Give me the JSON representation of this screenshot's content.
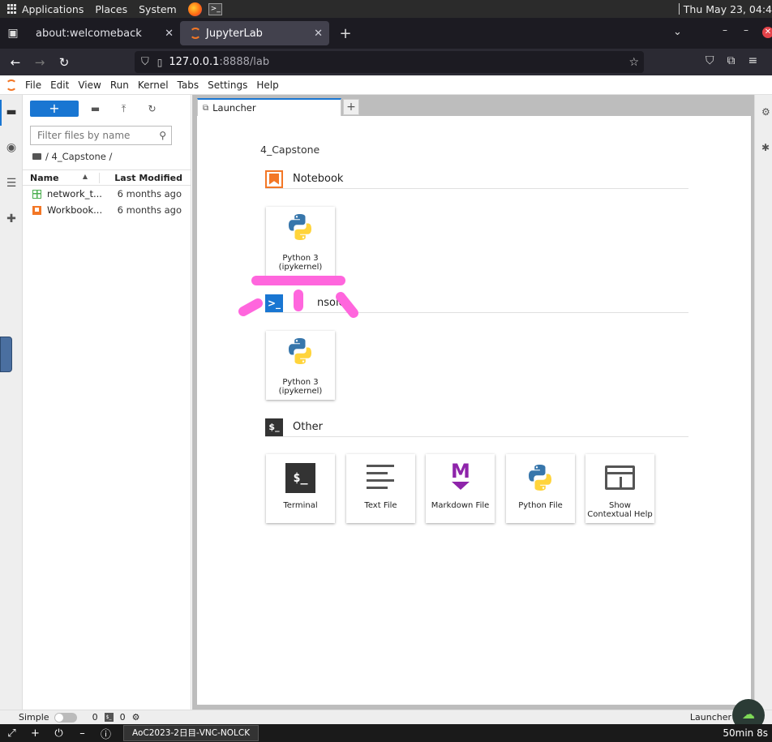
{
  "system_bar": {
    "applications": "Applications",
    "places": "Places",
    "system": "System",
    "datetime": "Thu May 23, 04:4"
  },
  "browser": {
    "tabs": [
      {
        "title": "about:welcomeback",
        "active": false
      },
      {
        "title": "JupyterLab",
        "active": true
      }
    ],
    "url_host": "127.0.0.1",
    "url_rest": ":8888/lab"
  },
  "jupyter_menu": [
    "File",
    "Edit",
    "View",
    "Run",
    "Kernel",
    "Tabs",
    "Settings",
    "Help"
  ],
  "file_browser": {
    "new_label": "+",
    "search_placeholder": "Filter files by name",
    "breadcrumb": "/ 4_Capstone /",
    "col_name": "Name",
    "col_modified": "Last Modified",
    "files": [
      {
        "name": "network_t...",
        "modified": "6 months ago",
        "type": "table"
      },
      {
        "name": "Workbook...",
        "modified": "6 months ago",
        "type": "notebook"
      }
    ]
  },
  "main_tab": {
    "title": "Launcher",
    "add": "+"
  },
  "launcher": {
    "path": "4_Capstone",
    "sections": {
      "notebook": {
        "title": "Notebook",
        "icon": "notebook-icon"
      },
      "console": {
        "title": "Console",
        "visible_title": "nsole",
        "icon": "console-icon"
      },
      "other": {
        "title": "Other",
        "icon": "terminal-icon"
      }
    },
    "notebook_cards": [
      {
        "line1": "Python 3",
        "line2": "(ipykernel)"
      }
    ],
    "console_cards": [
      {
        "line1": "Python 3",
        "line2": "(ipykernel)"
      }
    ],
    "other_cards": [
      {
        "line1": "Terminal",
        "line2": ""
      },
      {
        "line1": "Text File",
        "line2": ""
      },
      {
        "line1": "Markdown File",
        "line2": ""
      },
      {
        "line1": "Python File",
        "line2": ""
      },
      {
        "line1": "Show",
        "line2": "Contextual Help"
      }
    ]
  },
  "status_bar": {
    "mode": "Simple",
    "count_terminals": "0",
    "count_kernels": "0",
    "right_label": "Launcher"
  },
  "taskbar": {
    "task_label": "AoC2023-2日目-VNC-NOLCK",
    "timer": "50min 8s"
  },
  "colors": {
    "accent": "#1976d2",
    "jupyter_orange": "#f37726",
    "annotation_pink": "#ff66dd"
  }
}
